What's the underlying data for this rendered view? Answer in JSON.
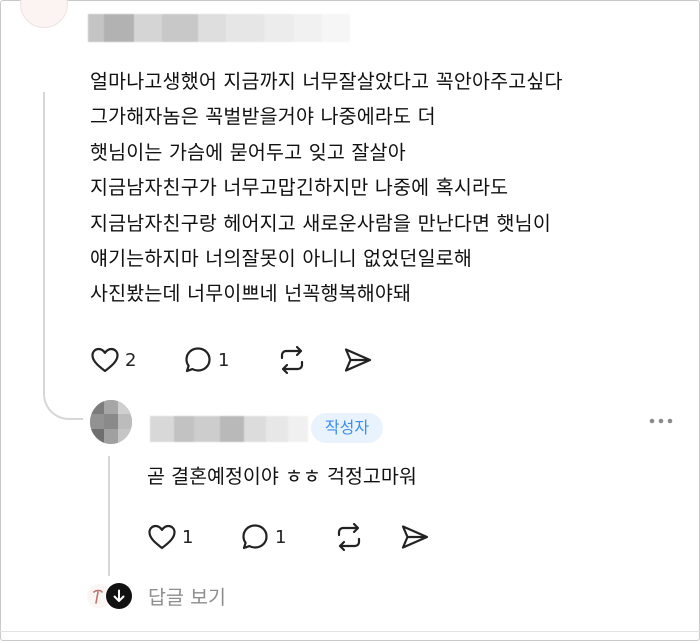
{
  "comment": {
    "lines": [
      "얼마나고생했어 지금까지 너무잘살았다고 꼭안아주고싶다",
      "그가해자놈은 꼭벌받을거야 나중에라도 더",
      "햇님이는 가슴에 묻어두고 잊고 잘살아",
      "지금남자친구가 너무고맙긴하지만 나중에 혹시라도",
      "지금남자친구랑 헤어지고 새로운사람을 만난다면 햇님이",
      "얘기는하지마 너의잘못이 아니니 없었던일로해",
      "사진봤는데 너무이쁘네 넌꼭행복해야돼"
    ],
    "like_count": "2",
    "reply_count": "1"
  },
  "reply": {
    "author_badge": "작성자",
    "text": "곧 결혼예정이야 ㅎㅎ 걱정고마워",
    "like_count": "1",
    "reply_count": "1"
  },
  "view_replies": {
    "label": "답글 보기"
  },
  "icons": {
    "like": "heart-icon",
    "reply": "speech-bubble-icon",
    "repost": "repost-icon",
    "share": "send-icon",
    "more": "more-dots-icon",
    "expand": "arrow-down-icon"
  },
  "colors": {
    "badge_text": "#3b8ee9",
    "badge_bg": "#e9f3fd",
    "muted_text": "#8e8e8e",
    "thread_line": "#d6d6d6"
  }
}
